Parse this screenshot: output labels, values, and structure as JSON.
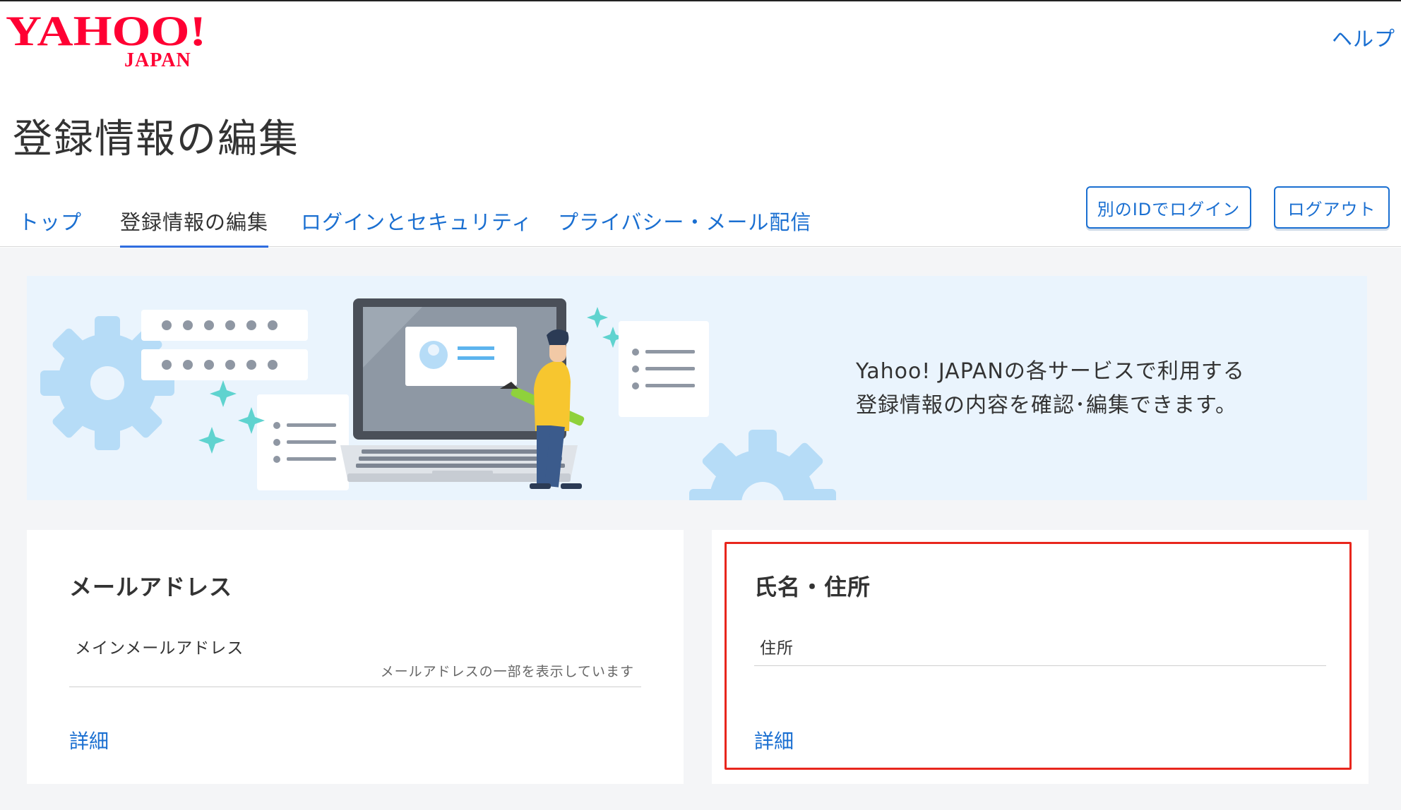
{
  "header": {
    "logo": {
      "main": "YAHOO!",
      "sub": "JAPAN"
    },
    "help_link": "ヘルプ"
  },
  "page": {
    "title": "登録情報の編集"
  },
  "tabs": [
    {
      "label": "トップ",
      "active": false
    },
    {
      "label": "登録情報の編集",
      "active": true
    },
    {
      "label": "ログインとセキュリティ",
      "active": false
    },
    {
      "label": "プライバシー・メール配信",
      "active": false
    }
  ],
  "actions": {
    "switch_id_label": "別のIDでログイン",
    "logout_label": "ログアウト"
  },
  "banner": {
    "line1": "Yahoo! JAPANの各サービスで利用する",
    "line2": "登録情報の内容を確認･編集できます。"
  },
  "cards": [
    {
      "title": "メールアドレス",
      "field_label": "メインメールアドレス",
      "field_note": "メールアドレスの一部を表示しています",
      "detail_link": "詳細"
    },
    {
      "title": "氏名・住所",
      "field_label": "住所",
      "detail_link": "詳細"
    }
  ],
  "colors": {
    "link": "#1a6fd1",
    "tab_underline": "#2f6de0",
    "highlight": "#e8261d",
    "logo_red": "#ff0033",
    "banner_bg": "#eaf4fd"
  }
}
